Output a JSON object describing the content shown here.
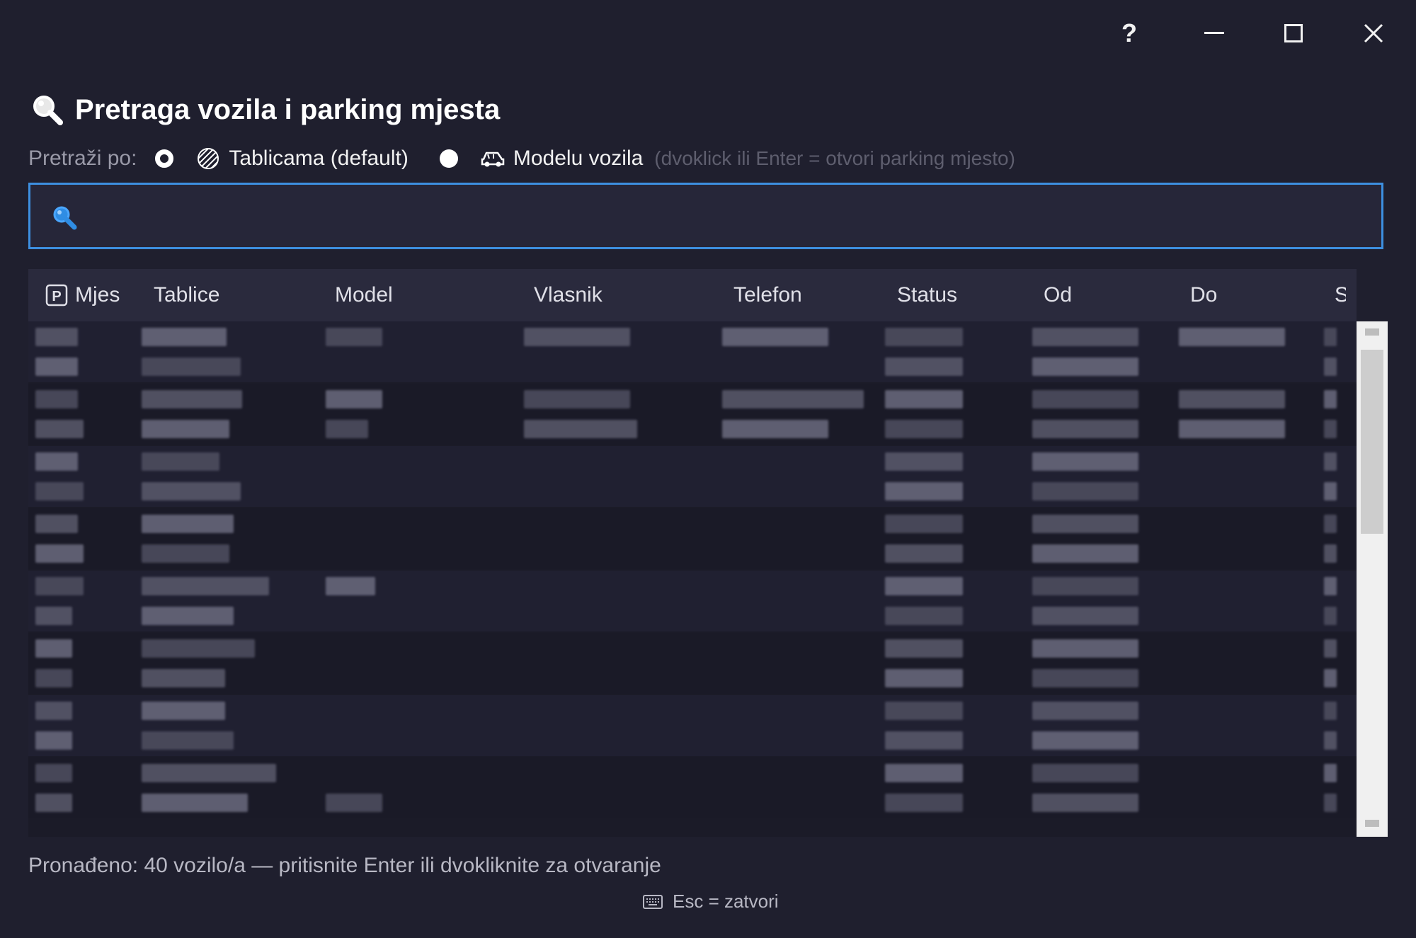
{
  "window": {
    "help_label": "?"
  },
  "header": {
    "title": "Pretraga vozila i parking mjesta"
  },
  "search_mode": {
    "label": "Pretraži po:",
    "options": [
      {
        "label": "Tablicama (default)",
        "selected": true
      },
      {
        "label": "Modelu vozila",
        "selected": false
      }
    ],
    "hint": "(dvoklick ili Enter = otvori parking mjesto)"
  },
  "search": {
    "value": "",
    "placeholder": ""
  },
  "table": {
    "columns": [
      "Mjes",
      "Tablice",
      "Model",
      "Vlasnik",
      "Telefon",
      "Status",
      "Od",
      "Do",
      "S"
    ],
    "row_count_visible": 16
  },
  "footer": {
    "status": "Pronađeno: 40 vozilo/a  — pritisnite Enter ili dvokliknite za otvaranje",
    "esc_hint": "Esc = zatvori"
  },
  "colors": {
    "background": "#1f1f2e",
    "accent": "#3d8fe0"
  }
}
